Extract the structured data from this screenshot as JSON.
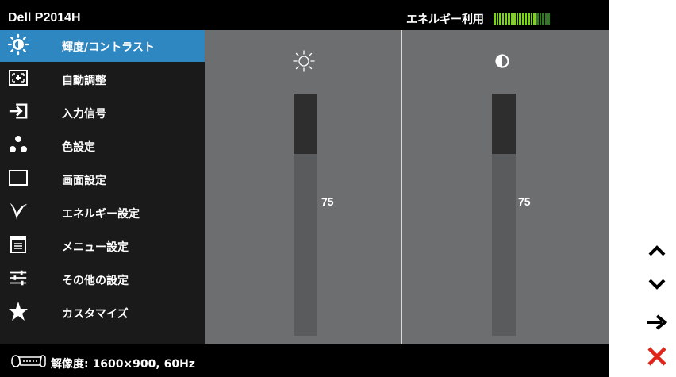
{
  "header": {
    "model": "Dell P2014H",
    "energy_label": "エネルギー利用"
  },
  "energy_meter": {
    "segments_total": 20,
    "segments_on": 15,
    "on_color": "#7cd318",
    "off_color": "#2d7a1f"
  },
  "sidebar": {
    "items": [
      {
        "label": "輝度/コントラスト",
        "icon": "brightness-icon",
        "selected": true
      },
      {
        "label": "自動調整",
        "icon": "auto-adjust-icon",
        "selected": false
      },
      {
        "label": "入力信号",
        "icon": "input-source-icon",
        "selected": false
      },
      {
        "label": "色設定",
        "icon": "color-settings-icon",
        "selected": false
      },
      {
        "label": "画面設定",
        "icon": "display-settings-icon",
        "selected": false
      },
      {
        "label": "エネルギー設定",
        "icon": "energy-leaf-icon",
        "selected": false
      },
      {
        "label": "メニュー設定",
        "icon": "menu-icon",
        "selected": false
      },
      {
        "label": "その他の設定",
        "icon": "other-settings-icon",
        "selected": false
      },
      {
        "label": "カスタマイズ",
        "icon": "star-icon",
        "selected": false
      }
    ]
  },
  "brightness": {
    "icon": "sun-icon",
    "value": "75"
  },
  "contrast": {
    "icon": "contrast-icon",
    "value": "75"
  },
  "status": {
    "icon": "connector-icon",
    "text": "解像度: 1600×900, 60Hz"
  },
  "buttons": [
    {
      "name": "up-button",
      "icon": "chevron-up-icon"
    },
    {
      "name": "down-button",
      "icon": "chevron-down-icon"
    },
    {
      "name": "enter-button",
      "icon": "arrow-right-icon"
    },
    {
      "name": "exit-button",
      "icon": "close-icon"
    }
  ],
  "colors": {
    "selected": "#2f87c2",
    "sidebar_bg": "#1a1a1a",
    "panel_bg": "#6d6e70",
    "exit_red": "#e0251b"
  }
}
